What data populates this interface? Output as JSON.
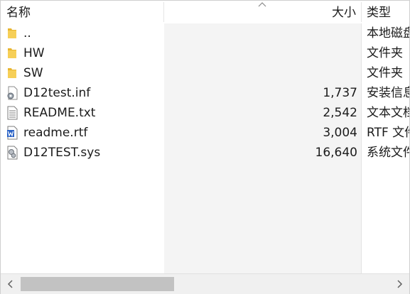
{
  "columns": {
    "name": "名称",
    "size": "大小",
    "type": "类型"
  },
  "files": [
    {
      "name": "..",
      "size": "",
      "type": "本地磁盘",
      "icon": "folder-icon"
    },
    {
      "name": "HW",
      "size": "",
      "type": "文件夹",
      "icon": "folder-icon"
    },
    {
      "name": "SW",
      "size": "",
      "type": "文件夹",
      "icon": "folder-icon"
    },
    {
      "name": "D12test.inf",
      "size": "1,737",
      "type": "安装信息",
      "icon": "setup-info-icon"
    },
    {
      "name": "README.txt",
      "size": "2,542",
      "type": "文本文档",
      "icon": "text-document-icon"
    },
    {
      "name": "readme.rtf",
      "size": "3,004",
      "type": "RTF 文件",
      "icon": "word-document-icon"
    },
    {
      "name": "D12TEST.sys",
      "size": "16,640",
      "type": "系统文件",
      "icon": "system-file-icon"
    }
  ],
  "colors": {
    "folder": "#f2c94c",
    "size_column_bg": "#f4f4f4",
    "scroll_thumb": "#c2c2c2"
  }
}
